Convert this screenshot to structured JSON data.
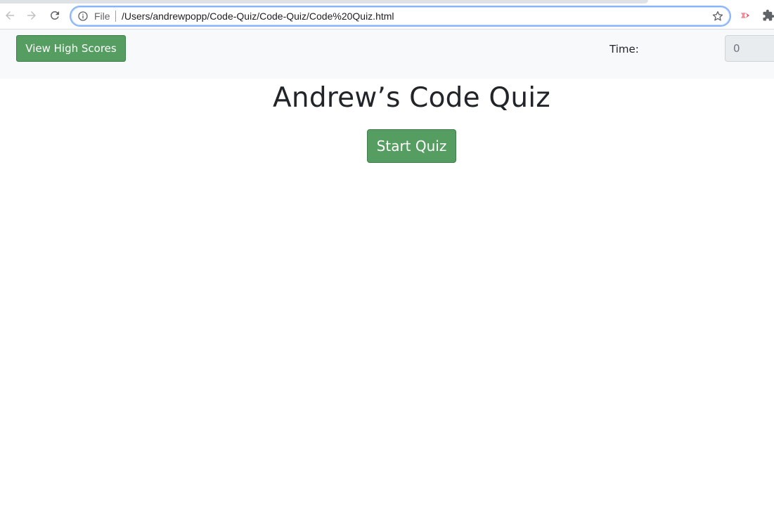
{
  "browser": {
    "url_scheme": "File",
    "url": "/Users/andrewpopp/Code-Quiz/Code-Quiz/Code%20Quiz.html",
    "icons": [
      "back-arrow-icon",
      "forward-arrow-icon",
      "reload-icon",
      "info-icon",
      "star-icon",
      "extension-icon",
      "puzzle-icon"
    ]
  },
  "navbar": {
    "high_scores_label": "View High Scores",
    "time_label": "Time:",
    "time_value": "0"
  },
  "main": {
    "title": "Andrew’s Code Quiz",
    "start_label": "Start Quiz"
  },
  "colors": {
    "button_green": "#559d61",
    "navbar_bg": "#f8f9fa",
    "omnibox_focus": "#8ab4f8"
  }
}
